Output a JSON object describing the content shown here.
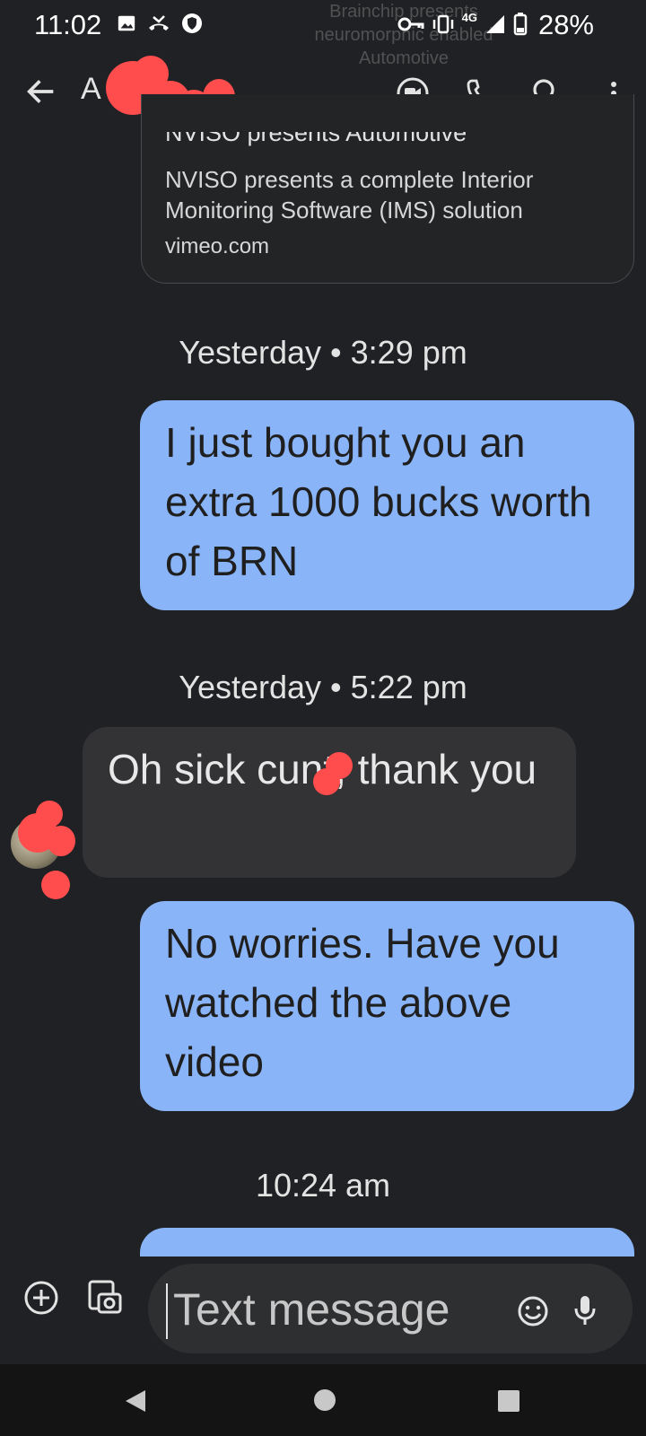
{
  "status_bar": {
    "time": "11:02",
    "network": "4G",
    "battery": "28%",
    "banner_lines": [
      "Brainchip presents",
      "neuromorphic enabled",
      "Automotive"
    ]
  },
  "app_bar": {
    "contact_name": "A",
    "actions": [
      "video-call",
      "phone-call",
      "search",
      "more-options"
    ]
  },
  "link_preview": {
    "title": "NVISO presents Automotive",
    "description": "NVISO presents a complete Interior Monitoring Software (IMS) solution",
    "domain": "vimeo.com"
  },
  "conversation": [
    {
      "type": "timestamp",
      "text": "Yesterday • 3:29 pm"
    },
    {
      "type": "outgoing",
      "text": "I just bought you an extra 1000 bucks worth of BRN"
    },
    {
      "type": "timestamp",
      "text": "Yesterday • 5:22 pm"
    },
    {
      "type": "incoming",
      "text": "Oh sick cunt, thank you"
    },
    {
      "type": "outgoing",
      "text": "No worries. Have you watched the above video"
    },
    {
      "type": "timestamp",
      "text": "10:24 am"
    }
  ],
  "compose": {
    "placeholder": "Text message"
  },
  "colors": {
    "background": "#202124",
    "outgoing_bubble": "#8ab4f8",
    "incoming_bubble": "#333335",
    "redaction": "#ff4d4d"
  }
}
